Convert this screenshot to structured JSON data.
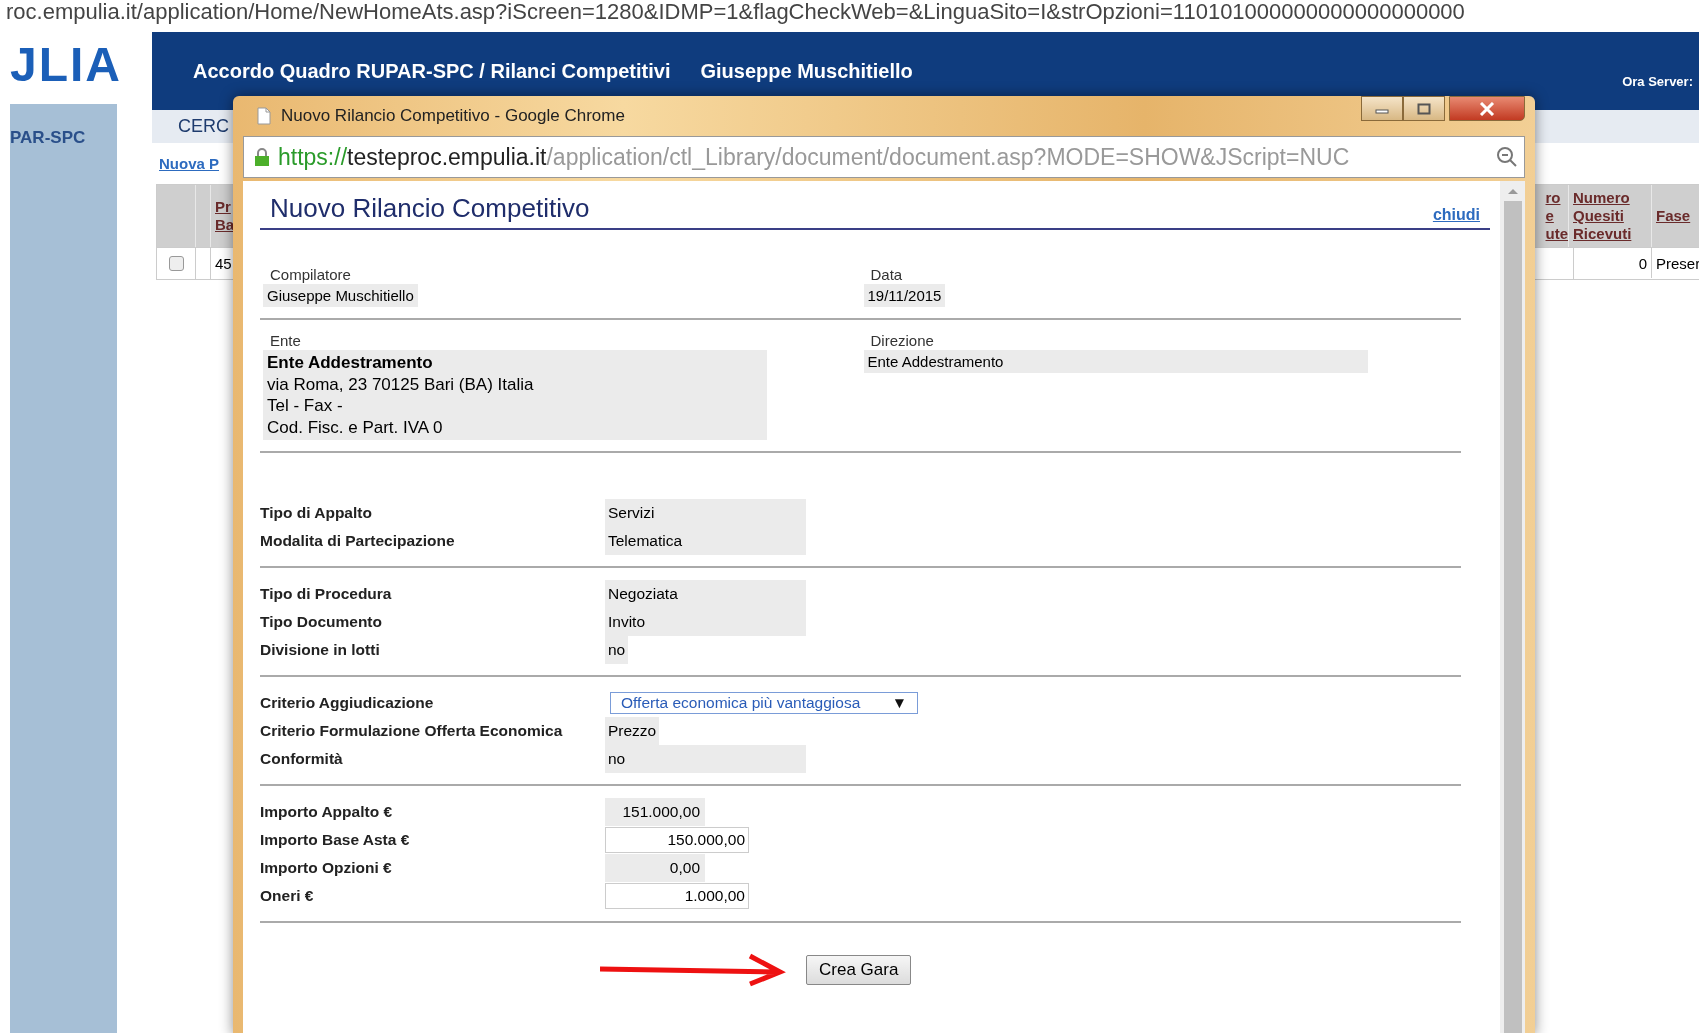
{
  "browser_url": "roc.empulia.it/application/Home/NewHomeAts.asp?iScreen=1280&IDMP=1&flagCheckWeb=&LinguaSito=I&strOpzioni=110101000000000000000000",
  "logo": "JLIA",
  "header": {
    "title": "Accordo Quadro RUPAR-SPC / Rilanci Competitivi",
    "user": "Giuseppe Muschitiello",
    "server_label": "Ora Server:"
  },
  "sidebar": {
    "title": "PAR-SPC"
  },
  "toolbar": {
    "tab": "CERC"
  },
  "new_link": "Nuova P",
  "table": {
    "left_columns": [
      "Pr\nBa"
    ],
    "right_columns": [
      "ro\ne\nute",
      "Numero\nQuesiti\nRicevuti",
      "Fase"
    ],
    "row": {
      "selected": false,
      "left_cells": [
        "45"
      ],
      "right_cells": [
        "0",
        "Preser"
      ]
    }
  },
  "popup": {
    "title": "Nuovo Rilancio Competitivo - Google Chrome",
    "url_scheme": "https://",
    "url_host": "testeproc.empulia.it",
    "url_path": "/application/ctl_Library/document/document.asp?MODE=SHOW&JScript=NUC",
    "heading": "Nuovo Rilancio Competitivo",
    "close_link": "chiudi",
    "top_fields": [
      {
        "label": "Compilatore",
        "value": "Giuseppe Muschitiello"
      },
      {
        "label": "Data",
        "value": "19/11/2015"
      }
    ],
    "ente": {
      "label": "Ente",
      "name": "Ente Addestramento",
      "lines": [
        "via Roma, 23 70125 Bari (BA) Italia",
        "Tel - Fax -",
        "Cod. Fisc. e Part. IVA 0"
      ]
    },
    "direzione": {
      "label": "Direzione",
      "value": "Ente Addestramento"
    },
    "sections": [
      [
        {
          "label": "Tipo di Appalto",
          "value": "Servizi",
          "kind": "text"
        },
        {
          "label": "Modalita di Partecipazione",
          "value": "Telematica",
          "kind": "text"
        }
      ],
      [
        {
          "label": "Tipo di Procedura",
          "value": "Negoziata",
          "kind": "text"
        },
        {
          "label": "Tipo Documento",
          "value": "Invito",
          "kind": "text"
        },
        {
          "label": "Divisione in lotti",
          "value": "no",
          "kind": "short"
        }
      ],
      [
        {
          "label": "Criterio Aggiudicazione",
          "value": "Offerta economica più vantaggiosa",
          "kind": "select"
        },
        {
          "label": "Criterio Formulazione Offerta Economica",
          "value": "Prezzo",
          "kind": "short"
        },
        {
          "label": "Conformità",
          "value": "no",
          "kind": "text"
        }
      ],
      [
        {
          "label": "Importo Appalto €",
          "value": "151.000,00",
          "kind": "amount"
        },
        {
          "label": "Importo Base Asta €",
          "value": "150.000,00",
          "kind": "input"
        },
        {
          "label": "Importo Opzioni €",
          "value": "0,00",
          "kind": "amount"
        },
        {
          "label": "Oneri €",
          "value": "1.000,00",
          "kind": "input"
        }
      ]
    ],
    "submit": "Crea Gara",
    "select_caret": "▼"
  }
}
